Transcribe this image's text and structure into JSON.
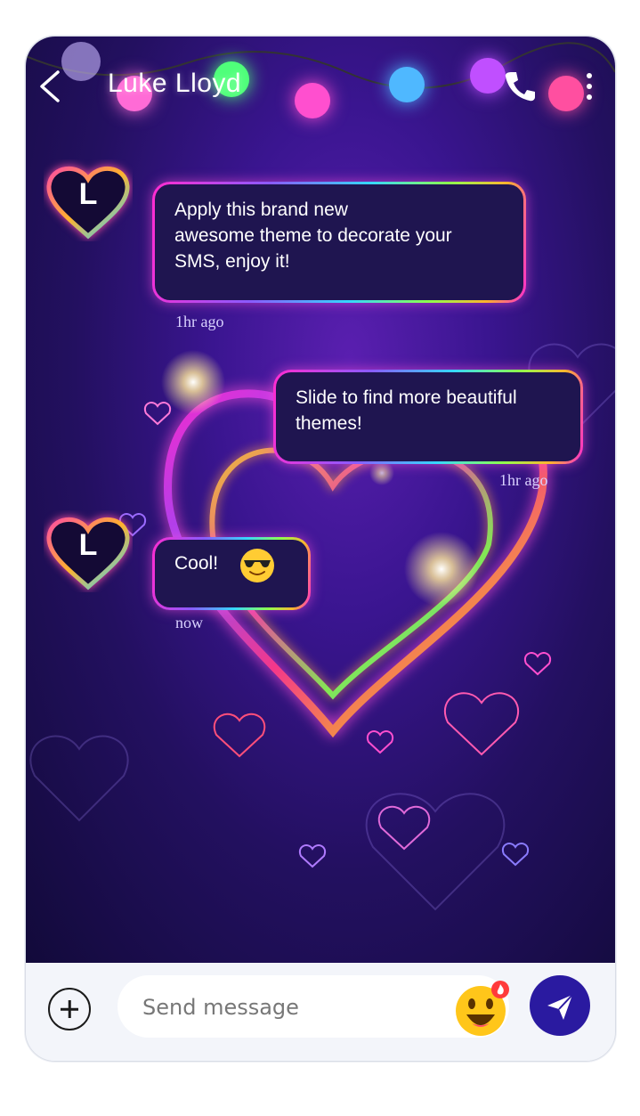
{
  "header": {
    "contact_name": "Luke Lloyd"
  },
  "messages": [
    {
      "sender": "incoming",
      "avatar_letter": "L",
      "text_lines": [
        "Apply this brand new",
        "awesome theme to decorate your",
        "SMS, enjoy it!"
      ],
      "time": "1hr ago"
    },
    {
      "sender": "outgoing",
      "text_lines": [
        "Slide to find more beautiful",
        "themes!"
      ],
      "time": "1hr ago"
    },
    {
      "sender": "incoming",
      "avatar_letter": "L",
      "text": "Cool!",
      "emoji": "sunglasses-face",
      "time": "now"
    }
  ],
  "composer": {
    "placeholder": "Send message",
    "emoji_button": "grinning-face-icon",
    "emoji_badge": "fire-badge"
  },
  "colors": {
    "background_top": "#3a1590",
    "background_dark": "#120a3a",
    "bubble_fill": "#1f1550",
    "send_button": "#2a1aa0",
    "composer_bg": "#f3f5fa"
  }
}
